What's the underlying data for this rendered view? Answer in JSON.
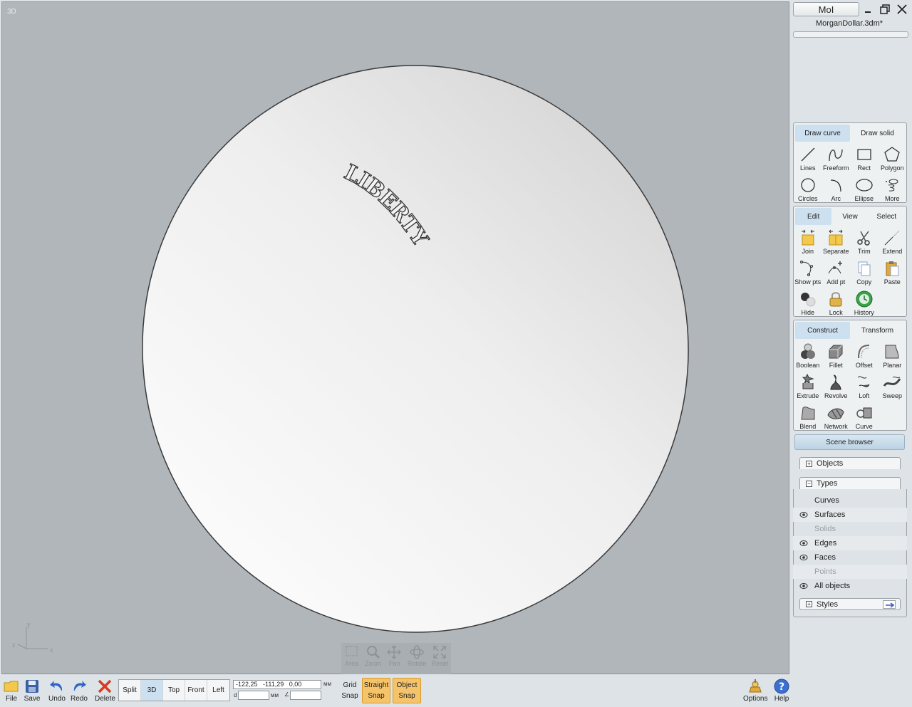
{
  "app": {
    "name": "MoI",
    "file_name": "MorganDollar.3dm*"
  },
  "viewport": {
    "label": "3D",
    "coin_text": "LIBERTY",
    "axes": {
      "x": "x",
      "y": "y",
      "z": "z"
    },
    "nav_controls": [
      "Area",
      "Zoom",
      "Pan",
      "Rotate",
      "Reset"
    ]
  },
  "bottombar": {
    "file": "File",
    "save": "Save",
    "undo": "Undo",
    "redo": "Redo",
    "delete": "Delete",
    "views": [
      "Split",
      "3D",
      "Top",
      "Front",
      "Left"
    ],
    "active_view": "3D",
    "coords": {
      "x": "-122,25",
      "y": "-111,29",
      "z": "0,00",
      "unit": "мм",
      "d_label": "d",
      "d_unit": "мм",
      "angle_label": "∠"
    },
    "grid_snap": [
      "Grid",
      "Snap"
    ],
    "straight_snap": [
      "Straight",
      "Snap"
    ],
    "object_snap": [
      "Object",
      "Snap"
    ],
    "options": "Options",
    "help": "Help"
  },
  "panel": {
    "draw_tabs": [
      "Draw curve",
      "Draw solid"
    ],
    "draw_tools": [
      "Lines",
      "Freeform",
      "Rect",
      "Polygon",
      "Circles",
      "Arc",
      "Ellipse",
      "More"
    ],
    "edit_tabs": [
      "Edit",
      "View",
      "Select"
    ],
    "edit_tools": [
      "Join",
      "Separate",
      "Trim",
      "Extend",
      "Show pts",
      "Add pt",
      "Copy",
      "Paste",
      "Hide",
      "Lock",
      "History"
    ],
    "construct_tabs": [
      "Construct",
      "Transform"
    ],
    "construct_tools": [
      "Boolean",
      "Fillet",
      "Offset",
      "Planar",
      "Extrude",
      "Revolve",
      "Loft",
      "Sweep",
      "Blend",
      "Network",
      "Curve"
    ],
    "scene_browser": "Scene browser",
    "objects_label": "Objects",
    "types_label": "Types",
    "types": [
      {
        "label": "Curves",
        "eye": false,
        "disabled": false
      },
      {
        "label": "Surfaces",
        "eye": true,
        "disabled": false
      },
      {
        "label": "Solids",
        "eye": false,
        "disabled": true
      },
      {
        "label": "Edges",
        "eye": true,
        "disabled": false
      },
      {
        "label": "Faces",
        "eye": true,
        "disabled": false
      },
      {
        "label": "Points",
        "eye": false,
        "disabled": true
      },
      {
        "label": "All objects",
        "eye": true,
        "disabled": false
      }
    ],
    "styles_label": "Styles"
  },
  "colors": {
    "viewport_bg": "#b1b6bb",
    "active_tab": "#cde0ef",
    "snap_on": "#f5c46a",
    "coin_edge": "#3a3a3a"
  }
}
